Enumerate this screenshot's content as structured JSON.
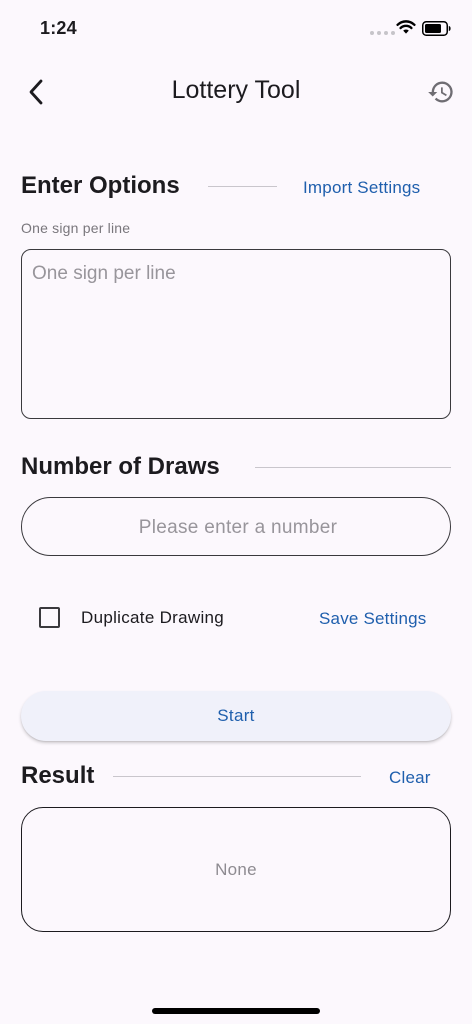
{
  "status_bar": {
    "time": "1:24"
  },
  "app_bar": {
    "title": "Lottery Tool"
  },
  "options_section": {
    "title": "Enter Options",
    "import_label": "Import Settings",
    "hint": "One sign per line",
    "placeholder": "One sign per line",
    "value": ""
  },
  "draws_section": {
    "title": "Number of Draws",
    "placeholder": "Please enter a number",
    "value": ""
  },
  "settings": {
    "duplicate_label": "Duplicate Drawing",
    "duplicate_checked": false,
    "save_label": "Save Settings"
  },
  "start_label": "Start",
  "result_section": {
    "title": "Result",
    "clear_label": "Clear",
    "value": "None"
  },
  "colors": {
    "accent": "#1f5fad",
    "background": "#fcf8fd",
    "button_bg": "#f0f1fa"
  }
}
